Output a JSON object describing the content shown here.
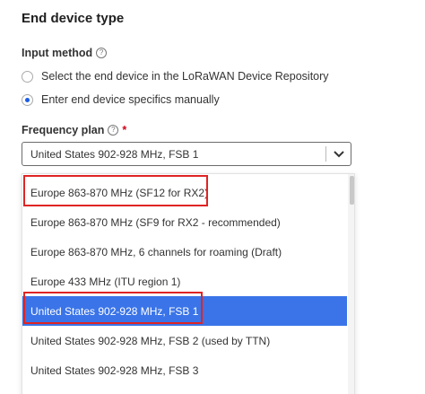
{
  "section": {
    "title": "End device type"
  },
  "input_method": {
    "label": "Input method",
    "help_icon": "help-circle-icon",
    "options": [
      {
        "label": "Select the end device in the LoRaWAN Device Repository",
        "checked": false
      },
      {
        "label": "Enter end device specifics manually",
        "checked": true
      }
    ]
  },
  "frequency_plan": {
    "label": "Frequency plan",
    "help_icon": "help-circle-icon",
    "required_mark": "*",
    "selected_value": "United States 902-928 MHz, FSB 1",
    "chevron_icon": "chevron-down-icon",
    "options": [
      "Europe 863-870 MHz (SF12 for RX2)",
      "Europe 863-870 MHz (SF9 for RX2 - recommended)",
      "Europe 863-870 MHz, 6 channels for roaming (Draft)",
      "Europe 433 MHz (ITU region 1)",
      "United States 902-928 MHz, FSB 1",
      "United States 902-928 MHz, FSB 2 (used by TTN)",
      "United States 902-928 MHz, FSB 3"
    ],
    "highlighted_index": 4
  },
  "colors": {
    "accent": "#3a74e8",
    "annotation": "#e02424",
    "required": "#d0021b"
  }
}
